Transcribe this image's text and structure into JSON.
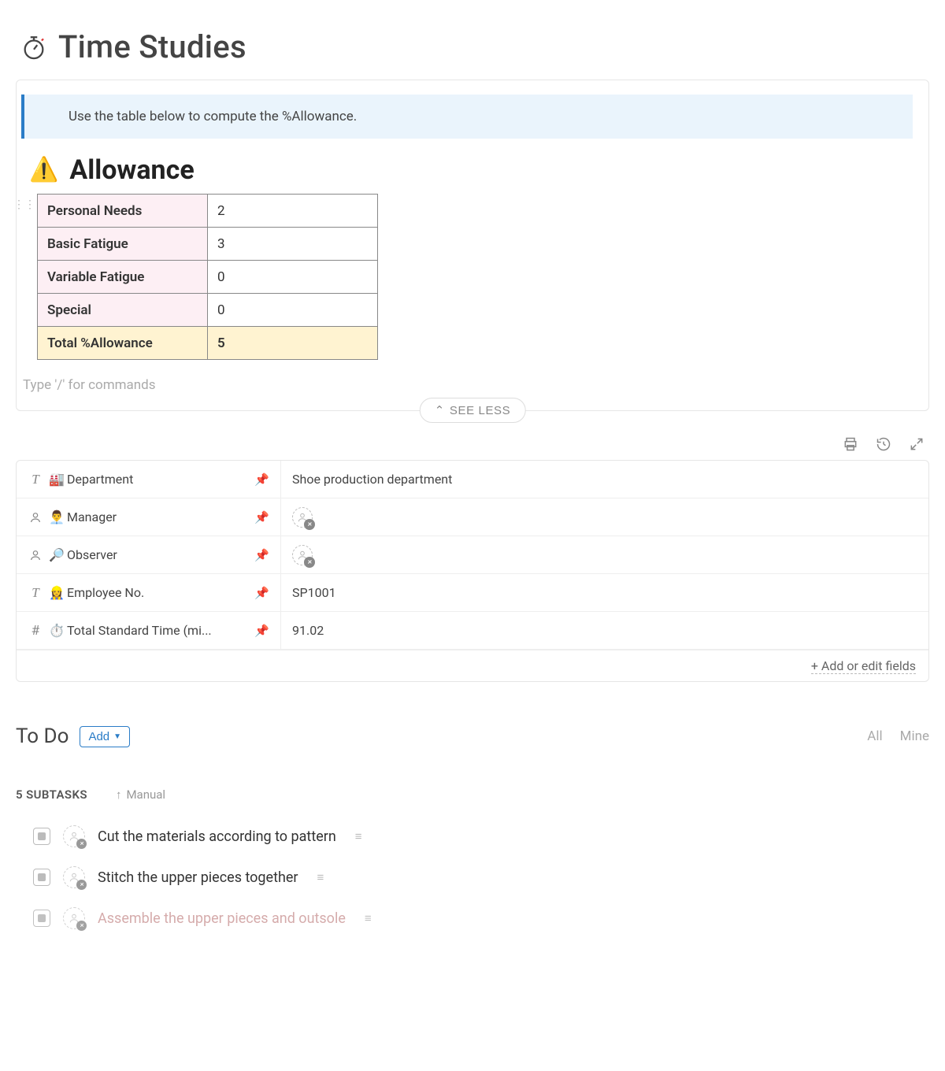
{
  "title": "Time Studies",
  "banner": "Use the table below to compute the %Allowance.",
  "allowance": {
    "heading": "Allowance",
    "rows": [
      {
        "label": "Personal Needs",
        "value": "2"
      },
      {
        "label": "Basic Fatigue",
        "value": "3"
      },
      {
        "label": "Variable Fatigue",
        "value": "0"
      },
      {
        "label": "Special",
        "value": "0"
      }
    ],
    "total_label": "Total %Allowance",
    "total_value": "5"
  },
  "slash_placeholder": "Type '/' for commands",
  "see_less": "SEE LESS",
  "fields": [
    {
      "type": "text",
      "emoji": "🏭",
      "label": "Department",
      "value": "Shoe production department"
    },
    {
      "type": "person",
      "emoji": "👨‍💼",
      "label": "Manager",
      "value": ""
    },
    {
      "type": "person",
      "emoji": "🔎",
      "label": "Observer",
      "value": ""
    },
    {
      "type": "text",
      "emoji": "👷‍♀️",
      "label": "Employee No.",
      "value": "SP1001"
    },
    {
      "type": "number",
      "emoji": "⏱️",
      "label": "Total Standard Time (mi...",
      "value": "91.02"
    }
  ],
  "fields_footer": "+ Add or edit fields",
  "todo": {
    "heading": "To Do",
    "add": "Add",
    "filters": {
      "all": "All",
      "mine": "Mine"
    },
    "subtasks_label": "5 SUBTASKS",
    "sort": "Manual",
    "tasks": [
      "Cut the materials according to pattern",
      "Stitch the upper pieces together",
      "Assemble the upper pieces and outsole"
    ]
  }
}
